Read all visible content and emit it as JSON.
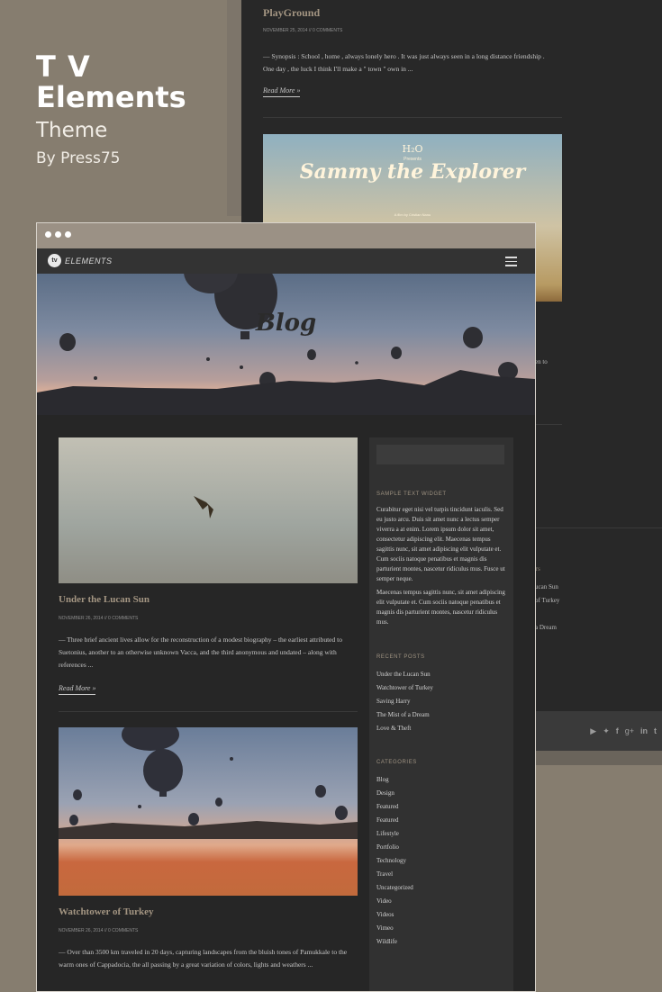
{
  "promo": {
    "line1": "T V",
    "line2": "Elements",
    "line3": "Theme",
    "line4": "By Press75"
  },
  "back_window": {
    "post_title": "PlayGround",
    "post_meta": "NOVEMBER 25, 2014 // 0 COMMENTS",
    "post_excerpt": "— Synopsis : School , home , always lonely hero . It was just always seen in a long distance friendship . One day , the luck I think I'll make a \" town \" own in ...",
    "read_more": "Read More »",
    "poster_logo": "H₂O",
    "poster_presents": "Presents",
    "poster_title": "Sammy the Explorer",
    "poster_sub": "A film by Cristian Nanu",
    "frag_to": "en to",
    "frag_sts": "TS",
    "frag_lucan": "ucan Sun",
    "frag_turkey": "of Turkey",
    "frag_dream": "a Dream",
    "social_icons": [
      "youtube-icon",
      "twitter-icon",
      "facebook-icon",
      "googleplus-icon",
      "linkedin-icon",
      "tumblr-icon"
    ]
  },
  "front_window": {
    "nav": {
      "logo_mark": "tv",
      "logo_text": "ELEMENTS"
    },
    "hero_title": "Blog",
    "posts": [
      {
        "title": "Under the Lucan Sun",
        "meta": "NOVEMBER 26, 2014 // 0 COMMENTS",
        "excerpt": "— Three brief ancient lives allow for the reconstruction of a modest biography – the earliest attributed to Suetonius, another to an otherwise unknown Vacca, and the third anonymous and undated – along with references ...",
        "read_more": "Read More »"
      },
      {
        "title": "Watchtower of Turkey",
        "meta": "NOVEMBER 26, 2014 // 0 COMMENTS",
        "excerpt": "— Over than 3500 km traveled in 20 days, capturing landscapes from the bluish tones of Pamukkale to the warm ones of Cappadocia, the all passing by a great variation of colors, lights and weathers ..."
      }
    ],
    "sidebar": {
      "widget_title": "SAMPLE TEXT WIDGET",
      "widget_p1": "Curabitur eget nisi vel turpis tincidunt iaculis. Sed eu justo arcu. Duis sit amet nunc a lectus semper viverra a at enim. Lorem ipsum dolor sit amet, consectetur adipiscing elit. Maecenas tempus sagittis nunc, sit amet adipiscing elit vulputate et. Cum sociis natoque penatibus et magnis dis parturient montes, nascetur ridiculus mus. Fusce ut semper neque.",
      "widget_p2": "Maecenas tempus sagittis nunc, sit amet adipiscing elit vulputate et. Cum sociis natoque penatibus et magnis dis parturient montes, nascetur ridiculus mus.",
      "recent_title": "RECENT POSTS",
      "recent": [
        "Under the Lucan Sun",
        "Watchtower of Turkey",
        "Saving Harry",
        "The Mist of a Dream",
        "Love & Theft"
      ],
      "categories_title": "CATEGORIES",
      "categories": [
        "Blog",
        "Design",
        "Featured",
        "Featured",
        "Lifestyle",
        "Portfolio",
        "Technology",
        "Travel",
        "Uncategorized",
        "Video",
        "Videos",
        "Vimeo",
        "Wildlife"
      ]
    }
  }
}
